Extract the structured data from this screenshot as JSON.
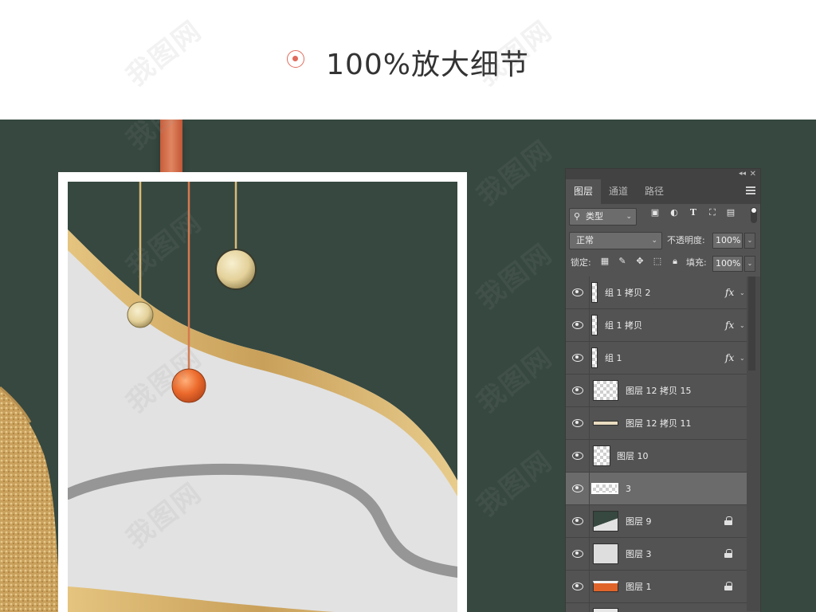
{
  "header": {
    "title": "100%放大细节"
  },
  "watermark": "我图网",
  "panel": {
    "tabs": [
      {
        "label": "图层",
        "active": true
      },
      {
        "label": "通道",
        "active": false
      },
      {
        "label": "路径",
        "active": false
      }
    ],
    "filter": {
      "label": "类型"
    },
    "blend_mode": "正常",
    "opacity_label": "不透明度:",
    "opacity_value": "100%",
    "lock_label": "锁定:",
    "fill_label": "填充:",
    "fill_value": "100%",
    "layers": [
      {
        "name": "组 1 拷贝 2",
        "fx": "fx",
        "thumb": "strip",
        "selected": false,
        "locked": false
      },
      {
        "name": "组 1 拷贝",
        "fx": "fx",
        "thumb": "strip",
        "selected": false,
        "locked": false
      },
      {
        "name": "组 1",
        "fx": "fx",
        "thumb": "strip",
        "selected": false,
        "locked": false
      },
      {
        "name": "图层 12 拷贝 15",
        "fx": "",
        "thumb": "checker-line",
        "selected": false,
        "locked": false
      },
      {
        "name": "图层 12 拷贝 11",
        "fx": "",
        "thumb": "thin-line",
        "selected": false,
        "locked": false
      },
      {
        "name": "图层 10",
        "fx": "",
        "thumb": "checker-narrow",
        "selected": false,
        "locked": false
      },
      {
        "name": "3",
        "fx": "",
        "thumb": "frame",
        "selected": true,
        "locked": false
      },
      {
        "name": "图层 9",
        "fx": "",
        "thumb": "dark",
        "selected": false,
        "locked": true
      },
      {
        "name": "图层 3",
        "fx": "",
        "thumb": "light",
        "selected": false,
        "locked": true
      },
      {
        "name": "图层 1",
        "fx": "",
        "thumb": "orange",
        "selected": false,
        "locked": true
      }
    ]
  },
  "colors": {
    "background_dark": "#364840",
    "accent": "#e06b5c",
    "gold": "#d8b56e",
    "orange": "#e0642a",
    "panel": "#535353"
  }
}
